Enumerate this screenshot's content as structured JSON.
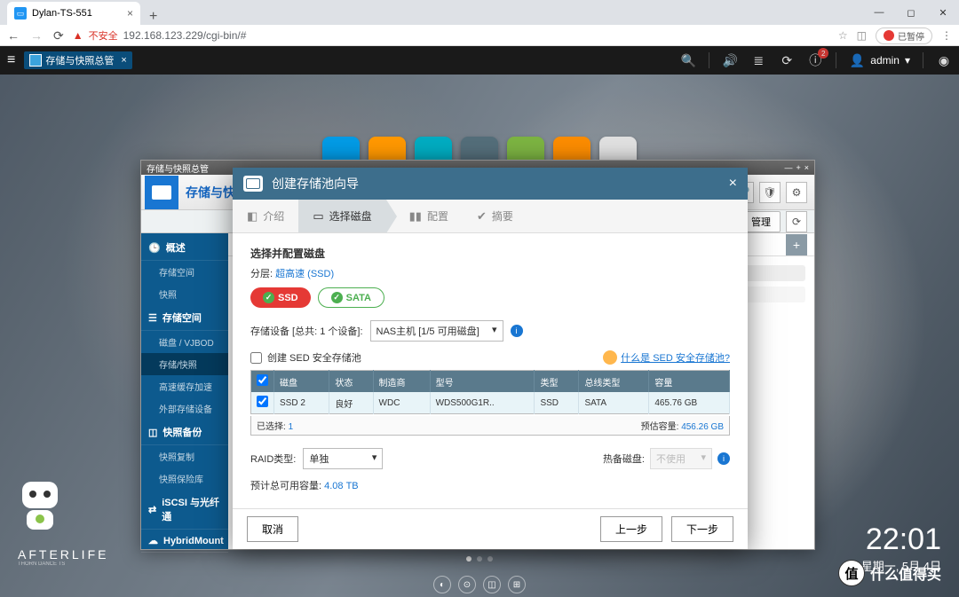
{
  "browser": {
    "tab_title": "Dylan-TS-551",
    "url": "192.168.123.229/cgi-bin/#",
    "insecure_label": "不安全",
    "pause_label": "已暂停"
  },
  "topbar": {
    "app_name": "存储与快照总管",
    "admin": "admin"
  },
  "storage_window": {
    "title": "存储与快照总管",
    "header_name": "存储与快照",
    "btn_manage": "管理",
    "sidebar": {
      "overview": "概述",
      "storage_space_item": "存储空间",
      "snapshot": "快照",
      "storage_section": "存储空间",
      "disk_vjbod": "磁盘 / VJBOD",
      "storage_snapshot": "存储/快照",
      "cache_accel": "高速缓存加速",
      "external": "外部存储设备",
      "backup_section": "快照备份",
      "snapshot_copy": "快照复制",
      "snapshot_vault": "快照保险库",
      "iscsi": "iSCSI 与光纤通",
      "hybridmount": "HybridMount"
    }
  },
  "wizard": {
    "title": "创建存储池向导",
    "steps": {
      "intro": "介绍",
      "select": "选择磁盘",
      "config": "配置",
      "summary": "摘要"
    },
    "section_title": "选择并配置磁盘",
    "tier_label": "分层:",
    "tier_value": "超高速 (SSD)",
    "pill_ssd": "SSD",
    "pill_sata": "SATA",
    "device_label": "存储设备 [总共: 1 个设备]:",
    "device_value": "NAS主机 [1/5 可用磁盘]",
    "sed_label": "创建 SED 安全存储池",
    "sed_link": "什么是 SED 安全存储池?",
    "table": {
      "headers": {
        "disk": "磁盘",
        "status": "状态",
        "vendor": "制造商",
        "model": "型号",
        "type": "类型",
        "bus": "总线类型",
        "capacity": "容量"
      },
      "rows": [
        {
          "disk": "SSD 2",
          "status": "良好",
          "vendor": "WDC",
          "model": "WDS500G1R..",
          "type": "SSD",
          "bus": "SATA",
          "capacity": "465.76 GB"
        }
      ]
    },
    "selected_label": "已选择:",
    "selected_count": "1",
    "estimate_label": "预估容量:",
    "estimate_value": "456.26 GB",
    "raid_label": "RAID类型:",
    "raid_value": "单独",
    "hotspare_label": "热备磁盘:",
    "hotspare_value": "不使用",
    "total_label": "预计总可用容量:",
    "total_value": "4.08 TB",
    "btn_cancel": "取消",
    "btn_prev": "上一步",
    "btn_next": "下一步"
  },
  "clock": {
    "time": "22:01",
    "date": "星期一, 5月 4日"
  },
  "watermark": "什么值得买"
}
